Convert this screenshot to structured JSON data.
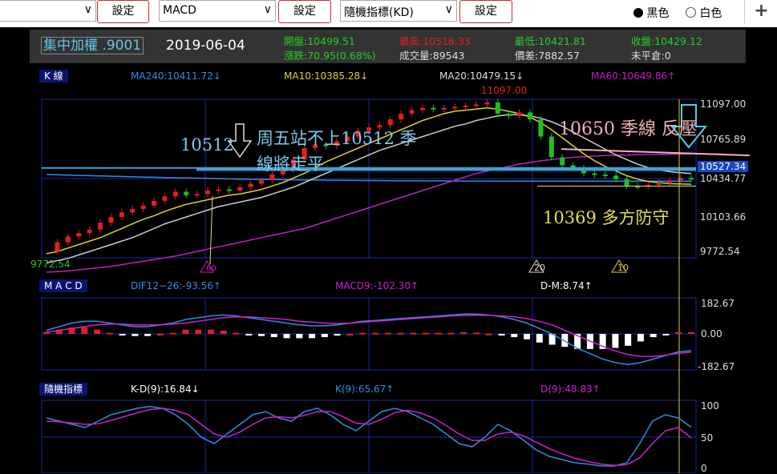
{
  "toolbar": {
    "select1": "",
    "set1": "設定",
    "select2": "MACD",
    "set2": "設定",
    "select3": "隨機指標(KD)",
    "set3": "設定",
    "theme_black": "黑色",
    "theme_white": "白色",
    "add": "+"
  },
  "header": {
    "symbol": "集中加權 .9001",
    "date": "2019-06-04",
    "open": "開盤:10499.51",
    "change": "漲跌:70.95(0.68%)",
    "high": "最高:10518.33",
    "volume": "成交量:89543",
    "low": "最低:10421.81",
    "diff": "價差:7882.57",
    "close": "收盤:10429.12",
    "unclosed": "未平倉:0"
  },
  "colors": {
    "ma240": "#2d8fe0",
    "ma10": "#e0d030",
    "ma20": "#cccccc",
    "ma60": "#c020c0",
    "up": "#e02020",
    "down": "#20c020",
    "dif": "#2d8fe0",
    "macd9": "#d020d0",
    "k": "#2d8fe0",
    "d": "#d020d0"
  },
  "kline": {
    "tag": "K 線",
    "ma240": "MA240:10411.72↓",
    "ma10": "MA10:10385.28↓",
    "ma20": "MA20:10479.15↓",
    "ma60": "MA60:10649.86↑",
    "axis": [
      "11097.00",
      "10765.89",
      "10527.34",
      "10434.77",
      "10103.66",
      "9772.54"
    ],
    "peak_label": "11097.00",
    "low_label": "9772.54",
    "markers": [
      "60",
      "20",
      "10"
    ]
  },
  "macd": {
    "tag": "M A C D",
    "dif": "DIF12−26:-93.56↑",
    "macd9": "MACD9:-102.30↑",
    "dm": "D-M:8.74↑",
    "axis": [
      "182.67",
      "0.00",
      "-182.67"
    ]
  },
  "kd": {
    "tag": "隨機指標",
    "kd": "K-D(9):16.84↓",
    "k": "K(9):65.67↑",
    "d": "D(9):48.83↑",
    "axis": [
      "100",
      "50",
      "0"
    ]
  },
  "annotations": {
    "a1": "10512",
    "a2": "周五站不上10512  季",
    "a3": "線將走平",
    "a4": "10650  季線 反壓",
    "a5": "10369  多方防守"
  },
  "chart_data": [
    {
      "type": "line",
      "title": "K 線",
      "series": [
        {
          "name": "Close",
          "values": [
            9800,
            9880,
            9930,
            9960,
            9990,
            10050,
            10100,
            10140,
            10170,
            10200,
            10240,
            10280,
            10320,
            10290,
            10300,
            10330,
            10340,
            10330,
            10360,
            10390,
            10420,
            10470,
            10512,
            10600,
            10700,
            10730,
            10720,
            10760,
            10800,
            10850,
            10880,
            10900,
            10950,
            11000,
            11030,
            11050,
            11040,
            11050,
            11060,
            11070,
            11080,
            11097,
            11000,
            10980,
            11010,
            10950,
            10800,
            10620,
            10550,
            10527,
            10480,
            10470,
            10460,
            10430,
            10370,
            10369,
            10380,
            10400,
            10420,
            10440,
            10429
          ]
        },
        {
          "name": "MA10:10385.28↓",
          "values": [
            9780,
            9800,
            9830,
            9860,
            9890,
            9920,
            9960,
            10000,
            10040,
            10080,
            10110,
            10150,
            10180,
            10210,
            10230,
            10250,
            10270,
            10290,
            10300,
            10320,
            10340,
            10370,
            10400,
            10440,
            10480,
            10530,
            10580,
            10620,
            10660,
            10700,
            10740,
            10780,
            10820,
            10860,
            10900,
            10940,
            10970,
            11000,
            11020,
            11030,
            11040,
            11050,
            11040,
            11020,
            11000,
            10970,
            10920,
            10860,
            10790,
            10720,
            10650,
            10590,
            10540,
            10500,
            10460,
            10430,
            10410,
            10400,
            10390,
            10388,
            10385
          ]
        },
        {
          "name": "MA20:10479.15↓",
          "values": [
            9700,
            9720,
            9740,
            9770,
            9800,
            9830,
            9860,
            9890,
            9920,
            9960,
            10000,
            10040,
            10070,
            10100,
            10130,
            10160,
            10190,
            10210,
            10230,
            10250,
            10270,
            10300,
            10330,
            10360,
            10400,
            10440,
            10480,
            10520,
            10560,
            10600,
            10640,
            10680,
            10710,
            10740,
            10770,
            10800,
            10830,
            10860,
            10890,
            10910,
            10940,
            10960,
            10980,
            10990,
            10990,
            10980,
            10960,
            10930,
            10890,
            10840,
            10790,
            10740,
            10690,
            10640,
            10600,
            10560,
            10530,
            10510,
            10495,
            10485,
            10479
          ]
        },
        {
          "name": "MA60:10649.86↑",
          "values": [
            9620,
            9625,
            9630,
            9640,
            9650,
            9660,
            9670,
            9685,
            9700,
            9715,
            9730,
            9745,
            9760,
            9780,
            9800,
            9820,
            9840,
            9860,
            9880,
            9900,
            9920,
            9940,
            9960,
            9980,
            10000,
            10030,
            10060,
            10090,
            10120,
            10150,
            10180,
            10210,
            10240,
            10270,
            10300,
            10330,
            10360,
            10390,
            10420,
            10450,
            10480,
            10500,
            10520,
            10540,
            10560,
            10575,
            10590,
            10600,
            10610,
            10620,
            10625,
            10630,
            10635,
            10638,
            10640,
            10642,
            10644,
            10646,
            10647,
            10648,
            10650
          ]
        },
        {
          "name": "MA240:10411.72↓",
          "values": [
            10470,
            10468,
            10465,
            10463,
            10460,
            10458,
            10455,
            10453,
            10450,
            10448,
            10446,
            10444,
            10442,
            10440,
            10438,
            10436,
            10434,
            10432,
            10430,
            10428,
            10427,
            10426,
            10425,
            10424,
            10423,
            10422,
            10421,
            10420,
            10419,
            10418,
            10417,
            10417,
            10416,
            10416,
            10415,
            10415,
            10414,
            10414,
            10414,
            10413,
            10413,
            10413,
            10413,
            10412,
            10412,
            10412,
            10412,
            10412,
            10412,
            10412,
            10412,
            10412,
            10412,
            10412,
            10412,
            10412,
            10412,
            10412,
            10412,
            10412,
            10412
          ]
        }
      ],
      "ylim": [
        9772.54,
        11097.0
      ]
    },
    {
      "type": "bar",
      "title": "M A C D",
      "series": [
        {
          "name": "DIF12−26:-93.56↑",
          "values": [
            20,
            40,
            60,
            70,
            70,
            60,
            50,
            40,
            40,
            50,
            60,
            80,
            90,
            100,
            105,
            100,
            90,
            80,
            70,
            60,
            50,
            45,
            45,
            50,
            60,
            70,
            75,
            80,
            85,
            90,
            95,
            100,
            105,
            110,
            110,
            105,
            95,
            80,
            60,
            30,
            0,
            -40,
            -80,
            -110,
            -140,
            -160,
            -170,
            -160,
            -140,
            -120,
            -100,
            -93.56
          ]
        },
        {
          "name": "MACD9:-102.30↑",
          "values": [
            10,
            20,
            30,
            40,
            50,
            55,
            55,
            50,
            50,
            50,
            55,
            60,
            70,
            80,
            90,
            95,
            95,
            90,
            85,
            80,
            70,
            65,
            60,
            58,
            60,
            65,
            70,
            75,
            80,
            85,
            90,
            95,
            100,
            102,
            104,
            104,
            100,
            95,
            85,
            70,
            50,
            20,
            -10,
            -40,
            -70,
            -95,
            -115,
            -125,
            -125,
            -118,
            -108,
            -102.3
          ]
        }
      ],
      "ylim": [
        -182.67,
        182.67
      ]
    },
    {
      "type": "line",
      "title": "隨機指標",
      "series": [
        {
          "name": "K(9):65.67↑",
          "values": [
            80,
            75,
            70,
            65,
            75,
            85,
            90,
            95,
            98,
            95,
            85,
            70,
            50,
            40,
            55,
            70,
            85,
            90,
            80,
            75,
            90,
            95,
            85,
            70,
            60,
            75,
            90,
            95,
            90,
            80,
            70,
            55,
            40,
            35,
            50,
            70,
            60,
            45,
            30,
            20,
            15,
            10,
            8,
            5,
            5,
            10,
            40,
            75,
            85,
            80,
            65.67
          ]
        },
        {
          "name": "D(9):48.83↑",
          "values": [
            75,
            74,
            72,
            70,
            71,
            76,
            82,
            88,
            93,
            95,
            92,
            85,
            70,
            55,
            50,
            58,
            70,
            80,
            82,
            80,
            84,
            90,
            90,
            82,
            72,
            70,
            78,
            88,
            92,
            88,
            80,
            68,
            55,
            45,
            45,
            55,
            58,
            52,
            42,
            32,
            24,
            17,
            12,
            8,
            6,
            7,
            18,
            40,
            60,
            65,
            48.83
          ]
        }
      ],
      "ylim": [
        0,
        100
      ]
    }
  ]
}
